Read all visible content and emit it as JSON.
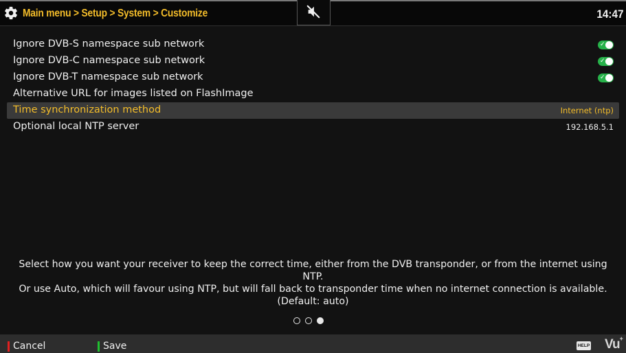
{
  "header": {
    "breadcrumb": "Main menu > Setup > System > Customize",
    "clock": "14:47",
    "mute_icon": "speaker-muted-icon",
    "settings_icon": "gear-icon"
  },
  "settings": [
    {
      "label": "Ignore DVB-S namespace sub network",
      "type": "toggle",
      "state": "on"
    },
    {
      "label": "Ignore DVB-C namespace sub network",
      "type": "toggle",
      "state": "on"
    },
    {
      "label": "Ignore DVB-T namespace sub network",
      "type": "toggle",
      "state": "on"
    },
    {
      "label": "Alternative URL for images listed on FlashImage",
      "type": "text",
      "value": ""
    },
    {
      "label": "Time synchronization method",
      "type": "select",
      "value": "Internet (ntp)",
      "selected": true
    },
    {
      "label": "Optional local NTP server",
      "type": "text",
      "value": "192.168.5.1"
    }
  ],
  "help": {
    "line1": "Select how you want your receiver to keep the correct time, either from the DVB transponder, or from the internet using NTP.",
    "line2": "Or use Auto, which will favour using NTP, but will fall back to transponder time when no internet connection is available.",
    "line3": "(Default: auto)"
  },
  "pagination": {
    "pages": 3,
    "current": 3
  },
  "footer": {
    "cancel_label": "Cancel",
    "save_label": "Save",
    "help_key": "HELP",
    "logo": "Vu",
    "logo_sup": "+",
    "cancel_color": "#e02020",
    "save_color": "#20c030"
  },
  "colors": {
    "accent": "#f4bd2a",
    "toggle_on": "#27b24a"
  }
}
